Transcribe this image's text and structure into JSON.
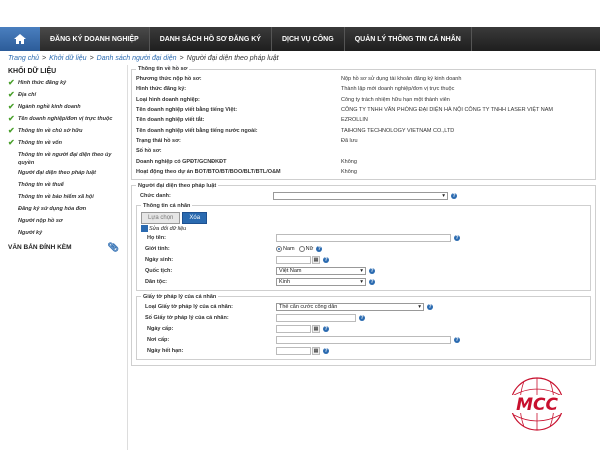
{
  "nav": {
    "items": [
      "ĐĂNG KÝ DOANH NGHIỆP",
      "DANH SÁCH HỒ SƠ ĐĂNG KÝ",
      "DỊCH VỤ CÔNG",
      "QUẢN LÝ THÔNG TIN CÁ NHÂN"
    ]
  },
  "breadcrumb": [
    "Trang chủ",
    "Khởi dữ liệu",
    "Danh sách người đại diện",
    "Người đại diện theo pháp luật"
  ],
  "sidebar": {
    "title": "KHỐI DỮ LIỆU",
    "items": [
      {
        "label": "Hình thức đăng ký",
        "done": true
      },
      {
        "label": "Địa chỉ",
        "done": true
      },
      {
        "label": "Ngành nghề kinh doanh",
        "done": true
      },
      {
        "label": "Tên doanh nghiệp/đơn vị trực thuộc",
        "done": true
      },
      {
        "label": "Thông tin về chủ sở hữu",
        "done": true
      },
      {
        "label": "Thông tin về vốn",
        "done": true
      },
      {
        "label": "Thông tin về người đại diện theo ủy quyền",
        "done": false
      },
      {
        "label": "Người đại diện theo pháp luật",
        "done": false
      },
      {
        "label": "Thông tin về thuế",
        "done": false
      },
      {
        "label": "Thông tin về bảo hiểm xã hội",
        "done": false
      },
      {
        "label": "Đăng ký sử dụng hóa đơn",
        "done": false
      },
      {
        "label": "Người nộp hồ sơ",
        "done": false
      },
      {
        "label": "Người ký",
        "done": false
      }
    ],
    "attach_label": "VĂN BẢN ĐÍNH KÈM"
  },
  "profile": {
    "legend": "Thông tin về hồ sơ",
    "rows": [
      {
        "label": "Phương thức nộp hồ sơ:",
        "value": "Nộp hồ sơ sử dụng tài khoản đăng ký kinh doanh"
      },
      {
        "label": "Hình thức đăng ký:",
        "value": "Thành lập mới doanh nghiệp/đơn vị trực thuộc"
      },
      {
        "label": "Loại hình doanh nghiệp:",
        "value": "Công ty trách nhiệm hữu hạn một thành viên"
      },
      {
        "label": "Tên doanh nghiệp viết bằng tiếng Việt:",
        "value": "CÔNG TY TNHH VĂN PHÒNG ĐẠI DIỆN HÀ NỘI CÔNG TY TNHH LASER VIỆT NAM"
      },
      {
        "label": "Tên doanh nghiệp viết tắt:",
        "value": "EZROLLIN"
      },
      {
        "label": "Tên doanh nghiệp viết bằng tiếng nước ngoài:",
        "value": "TAIHONG TECHNOLOGY VIETNAM CO.,LTD"
      },
      {
        "label": "Trạng thái hồ sơ:",
        "value": "Đã lưu"
      },
      {
        "label": "Số hồ sơ:",
        "value": ""
      },
      {
        "label": "Doanh nghiệp có GPĐT/GCNĐKĐT",
        "value": "Không"
      },
      {
        "label": "Hoạt động theo dự án BOT/BTO/BT/BOO/BLT/BTL/O&M",
        "value": "Không"
      }
    ]
  },
  "rep": {
    "legend": "Người đại diện theo pháp luật",
    "title_label": "Chức danh:",
    "personal_legend": "Thông tin cá nhân",
    "select_btn": "Lựa chọn",
    "delete_btn": "Xóa",
    "edit_label": "Sửa đổi dữ liệu",
    "name_label": "Họ tên:",
    "gender_label": "Giới tính:",
    "male": "Nam",
    "female": "Nữ",
    "dob_label": "Ngày sinh:",
    "nationality_label": "Quốc tịch:",
    "nationality_value": "Việt Nam",
    "ethnic_label": "Dân tộc:",
    "ethnic_value": "Kinh"
  },
  "docs": {
    "legend": "Giấy tờ pháp lý của cá nhân",
    "type_label": "Loại Giấy tờ pháp lý của cá nhân:",
    "type_value": "Thẻ căn cước công dân",
    "number_label": "Số Giấy tờ pháp lý của cá nhân:",
    "issue_date_label": "Ngày cấp:",
    "issue_place_label": "Nơi cấp:",
    "expiry_label": "Ngày hết hạn:"
  },
  "logo": {
    "text": "MCC"
  },
  "colors": {
    "accent": "#2a6ab0",
    "check": "#4aa02c",
    "logo_red": "#c8102e"
  }
}
